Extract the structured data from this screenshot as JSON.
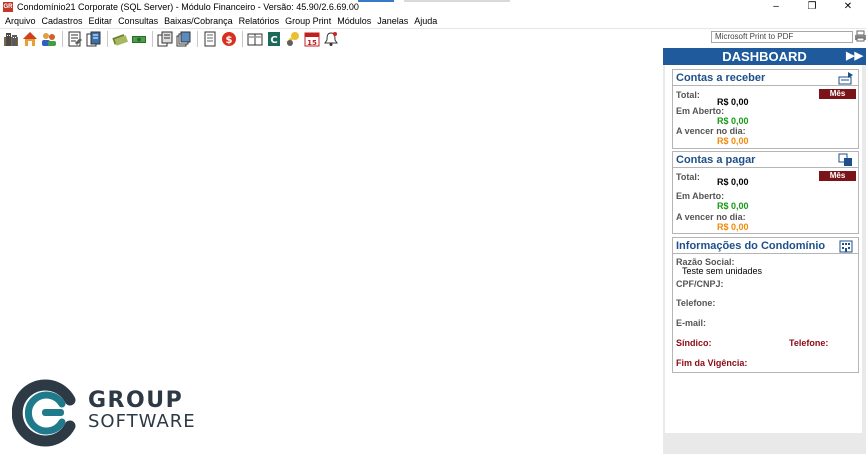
{
  "window": {
    "title": "Condomínio21 Corporate  (SQL Server)  - Módulo Financeiro - Versão: 45.90/2.6.69.00",
    "app_icon_text": "GR",
    "controls": [
      "–",
      "❐",
      "✕"
    ]
  },
  "menu": [
    "Arquivo",
    "Cadastros",
    "Editar",
    "Consultas",
    "Baixas/Cobrança",
    "Relatórios",
    "Group Print",
    "Módulos",
    "Janelas",
    "Ajuda"
  ],
  "toolbar": {
    "printer": "Microsoft Print to PDF"
  },
  "logo": {
    "line1": "GROUP",
    "line2": "SOFTWARE"
  },
  "dashboard": {
    "title": "DASHBOARD",
    "arrows": "▶▶",
    "receber": {
      "title": "Contas a receber",
      "mes": "Mês",
      "total_label": "Total:",
      "total_value": "R$ 0,00",
      "aberto_label": "Em Aberto:",
      "aberto_value": "R$ 0,00",
      "vencer_label": "A vencer no dia:",
      "vencer_value": "R$ 0,00"
    },
    "pagar": {
      "title": "Contas a pagar",
      "mes": "Mês",
      "total_label": "Total:",
      "total_value": "R$ 0,00",
      "aberto_label": "Em Aberto:",
      "aberto_value": "R$ 0,00",
      "vencer_label": "A vencer no dia:",
      "vencer_value": "R$ 0,00"
    },
    "info": {
      "title": "Informações do Condomínio",
      "razao_label": "Razão Social:",
      "razao_value": "Teste sem unidades",
      "cpf_label": "CPF/CNPJ:",
      "telefone_label": "Telefone:",
      "email_label": "E-mail:",
      "sindico_label": "Síndico:",
      "sindico_tel_label": "Telefone:",
      "vigencia_label": "Fim da Vigência:"
    }
  }
}
